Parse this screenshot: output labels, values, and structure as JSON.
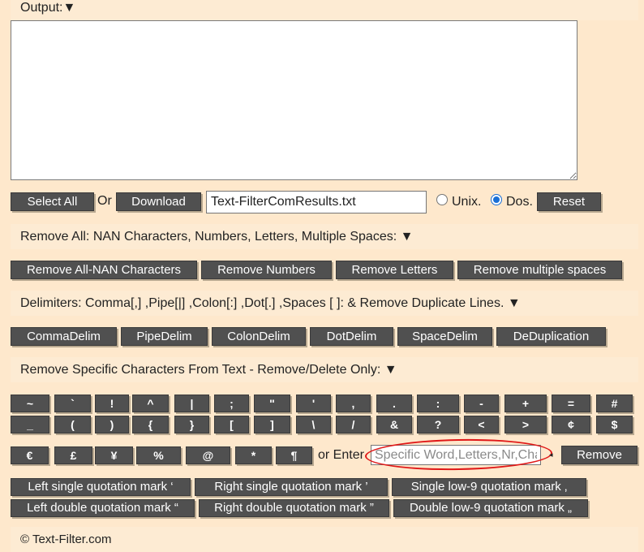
{
  "output": {
    "label": "Output:",
    "arrow": "▼",
    "value": ""
  },
  "controls": {
    "select_all": "Select All",
    "or": "Or",
    "download": "Download",
    "filename": "Text-FilterComResults.txt",
    "unix": "Unix.",
    "dos": "Dos.",
    "line_ending_selected": "Dos.",
    "reset": "Reset"
  },
  "remove_all": {
    "title": "Remove All: NAN Characters, Numbers, Letters, Multiple Spaces: ▼",
    "buttons": [
      "Remove All-NAN Characters",
      "Remove Numbers",
      "Remove Letters",
      "Remove multiple spaces"
    ]
  },
  "delimiters": {
    "title": "Delimiters: Comma[,] ,Pipe[|] ,Colon[:] ,Dot[.] ,Spaces [ ]: & Remove Duplicate Lines. ▼",
    "buttons": [
      "CommaDelim",
      "PipeDelim",
      "ColonDelim",
      "DotDelim",
      "SpaceDelim",
      "DeDuplication"
    ]
  },
  "specific": {
    "title": "Remove Specific Characters From Text - Remove/Delete Only: ▼",
    "row1": [
      "~",
      "`",
      "!",
      "^",
      "|",
      ";",
      "\"",
      "'",
      ",",
      ".",
      ":",
      "-",
      "+",
      "=",
      "#"
    ],
    "row2": [
      "_",
      "(",
      ")",
      "{",
      "}",
      "[",
      "]",
      "\\",
      "/",
      "&",
      "?",
      "<",
      ">",
      "¢",
      "$"
    ],
    "row3": [
      "€",
      "£",
      "¥",
      "%",
      "@",
      "*",
      "¶"
    ],
    "or_enter": "or Enter",
    "placeholder": "Specific Word,Letters,Nr,Chars",
    "remove": "Remove"
  },
  "quotes": {
    "row1": [
      "Left single quotation mark ‘",
      "Right single quotation mark ’",
      "Single low-9 quotation mark ‚"
    ],
    "row2": [
      "Left double quotation mark “",
      "Right double quotation mark ”",
      "Double low-9 quotation mark „"
    ]
  },
  "footer": {
    "text": "© Text-Filter.com"
  }
}
